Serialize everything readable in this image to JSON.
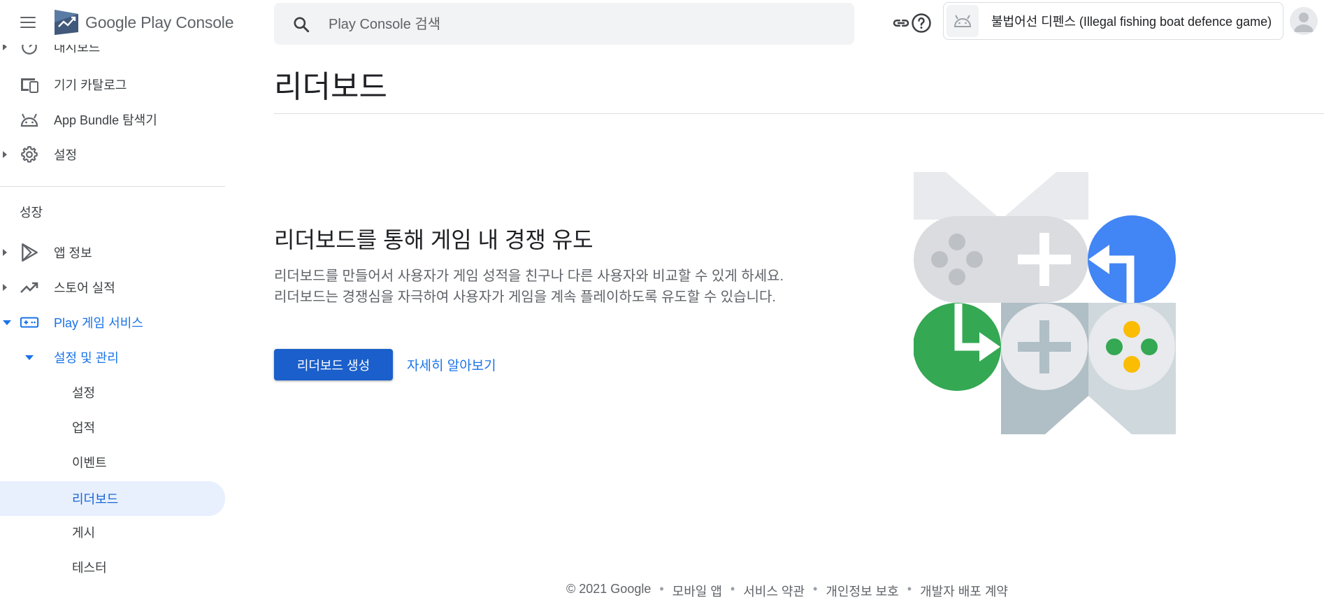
{
  "header": {
    "logo_google": "Google Play",
    "logo_console": "Console",
    "search_placeholder": "Play Console 검색",
    "app_name": "불법어선 디펜스 (Illegal fishing boat defence game)"
  },
  "sidebar": {
    "partial_item": "대시보드",
    "items_top": [
      {
        "label": "기기 카탈로그",
        "icon": "device-catalog-icon"
      },
      {
        "label": "App Bundle 탐색기",
        "icon": "android-icon"
      },
      {
        "label": "설정",
        "icon": "gear-icon"
      }
    ],
    "section_title": "성장",
    "items_growth": [
      {
        "label": "앱 정보",
        "icon": "play-icon"
      },
      {
        "label": "스토어 실적",
        "icon": "trending-icon"
      },
      {
        "label": "Play 게임 서비스",
        "icon": "gamepad-icon"
      },
      {
        "label": "설정 및 관리"
      }
    ],
    "sub_items": [
      "설정",
      "업적",
      "이벤트",
      "리더보드",
      "게시",
      "테스터"
    ]
  },
  "main": {
    "page_title": "리더보드",
    "promo_heading": "리더보드를 통해 게임 내 경쟁 유도",
    "promo_desc": "리더보드를 만들어서 사용자가 게임 성적을 친구나 다른 사용자와 비교할 수 있게 하세요. 리더보드는 경쟁심을 자극하여 사용자가 게임을 계속 플레이하도록 유도할 수 있습니다.",
    "create_button": "리더보드 생성",
    "learn_more": "자세히 알아보기"
  },
  "footer": {
    "copyright": "© 2021 Google",
    "links": [
      "모바일 앱",
      "서비스 약관",
      "개인정보 보호",
      "개발자 배포 계약"
    ]
  },
  "colors": {
    "accent": "#1a73e8",
    "button": "#1a5fcb",
    "selected_bg": "#e8f0fe",
    "illus_blue": "#4285f4",
    "illus_green": "#34a853",
    "illus_yellow": "#fbbc04"
  }
}
